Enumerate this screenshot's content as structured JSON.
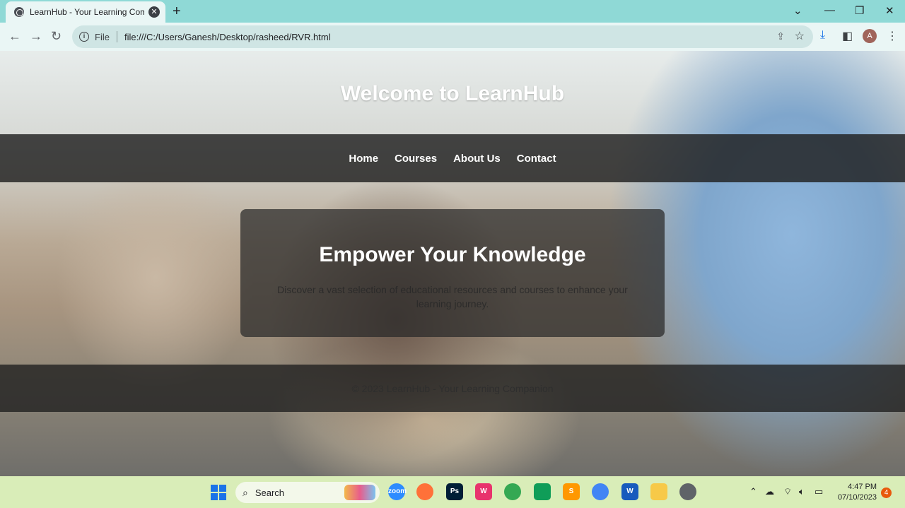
{
  "browser": {
    "tab_title": "LearnHub - Your Learning Comp",
    "url_scheme": "File",
    "url": "file:///C:/Users/Ganesh/Desktop/rasheed/RVR.html",
    "profile_initial": "A"
  },
  "page": {
    "hero_title": "Welcome to LearnHub",
    "nav": [
      "Home",
      "Courses",
      "About Us",
      "Contact"
    ],
    "card_title": "Empower Your Knowledge",
    "card_text": "Discover a vast selection of educational resources and courses to enhance your learning journey.",
    "footer_text": "© 2023 LearnHub - Your Learning Companion"
  },
  "taskbar": {
    "search_label": "Search",
    "time": "4:47 PM",
    "date": "07/10/2023",
    "notification_count": "4",
    "apps": [
      {
        "name": "zoom",
        "label": "zoom",
        "color": "#2d8cff"
      },
      {
        "name": "firefox",
        "label": "",
        "color": "#ff7139"
      },
      {
        "name": "photoshop",
        "label": "Ps",
        "color": "#001e36"
      },
      {
        "name": "wps",
        "label": "W",
        "color": "#e8336d"
      },
      {
        "name": "chrome",
        "label": "",
        "color": "#34a853"
      },
      {
        "name": "classroom",
        "label": "",
        "color": "#0f9d58"
      },
      {
        "name": "sublime",
        "label": "S",
        "color": "#ff9800"
      },
      {
        "name": "chrome-profile",
        "label": "",
        "color": "#4285f4"
      },
      {
        "name": "word",
        "label": "W",
        "color": "#185abd"
      },
      {
        "name": "file-explorer",
        "label": "",
        "color": "#f7c948"
      },
      {
        "name": "settings",
        "label": "",
        "color": "#5f6368"
      }
    ]
  }
}
